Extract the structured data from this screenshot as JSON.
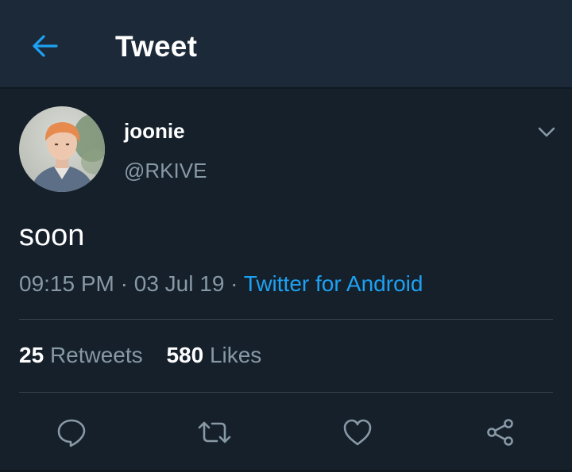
{
  "header": {
    "title": "Tweet",
    "back_icon": "arrow-left-icon"
  },
  "colors": {
    "background": "#15202b",
    "header_background": "#1c2938",
    "accent": "#1da1f2",
    "secondary_text": "#8899a6",
    "divider": "#38444d"
  },
  "tweet": {
    "display_name": "joonie",
    "handle": "@RKIVE",
    "text": "soon",
    "time": "09:15 PM",
    "separator": " · ",
    "date": "03 Jul 19",
    "source": "Twitter for Android",
    "menu_icon": "chevron-down-icon"
  },
  "stats": {
    "retweets_count": "25",
    "retweets_label": "Retweets",
    "likes_count": "580",
    "likes_label": "Likes"
  },
  "actions": [
    {
      "name": "reply",
      "icon": "speech-bubble-icon"
    },
    {
      "name": "retweet",
      "icon": "retweet-arrows-icon"
    },
    {
      "name": "like",
      "icon": "heart-icon"
    },
    {
      "name": "share",
      "icon": "share-nodes-icon"
    }
  ]
}
